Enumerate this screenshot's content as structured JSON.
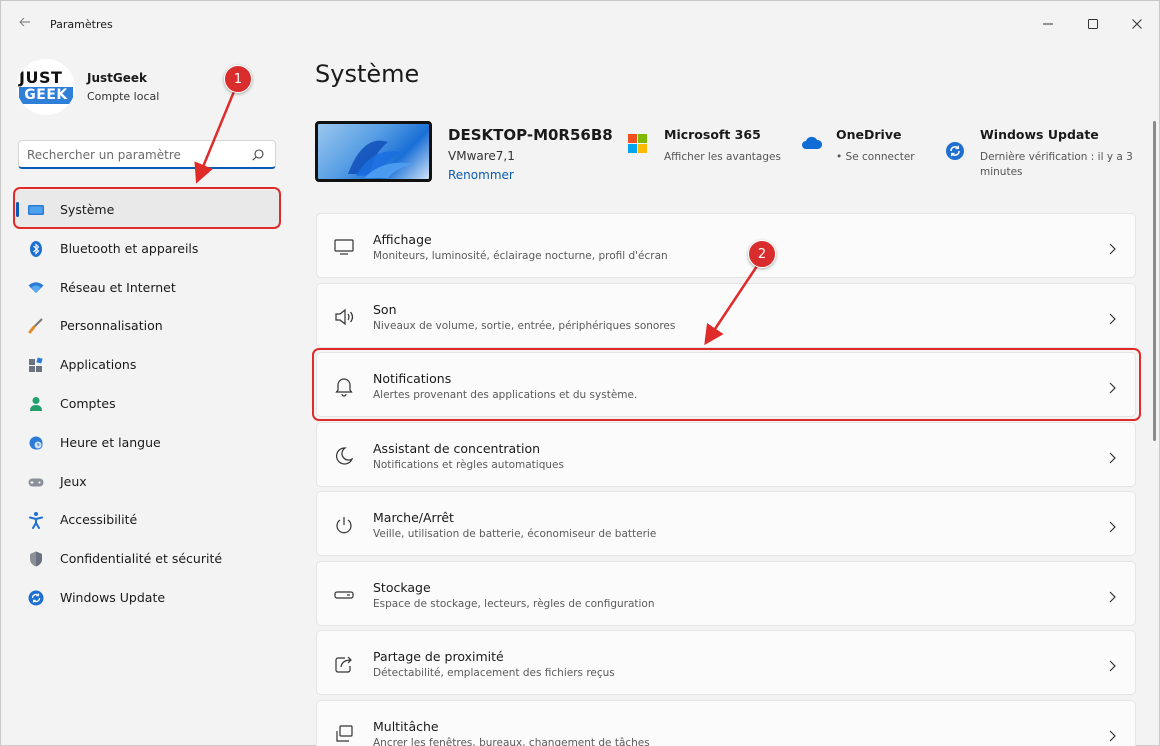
{
  "window": {
    "title": "Paramètres",
    "back_icon": "back-arrow-icon",
    "controls": [
      "minimize-icon",
      "maximize-icon",
      "close-icon"
    ]
  },
  "profile": {
    "logo_line1": "JUST",
    "logo_line2": "GEEK",
    "name": "JustGeek",
    "subtitle": "Compte local"
  },
  "search": {
    "placeholder": "Rechercher un paramètre",
    "value": ""
  },
  "sidebar": {
    "items": [
      {
        "label": "Système",
        "icon": "monitor-icon",
        "active": true
      },
      {
        "label": "Bluetooth et appareils",
        "icon": "bluetooth-icon"
      },
      {
        "label": "Réseau et Internet",
        "icon": "wifi-icon"
      },
      {
        "label": "Personnalisation",
        "icon": "brush-icon"
      },
      {
        "label": "Applications",
        "icon": "apps-icon"
      },
      {
        "label": "Comptes",
        "icon": "person-icon"
      },
      {
        "label": "Heure et langue",
        "icon": "globe-clock-icon"
      },
      {
        "label": "Jeux",
        "icon": "gamepad-icon"
      },
      {
        "label": "Accessibilité",
        "icon": "accessibility-icon"
      },
      {
        "label": "Confidentialité et sécurité",
        "icon": "shield-icon"
      },
      {
        "label": "Windows Update",
        "icon": "update-icon"
      }
    ]
  },
  "main": {
    "title": "Système",
    "device": {
      "name": "DESKTOP-M0R56B8",
      "model": "VMware7,1",
      "rename": "Renommer"
    },
    "info": [
      {
        "title": "Microsoft 365",
        "subtitle": "Afficher les avantages",
        "icon": "microsoft-logo-icon"
      },
      {
        "title": "OneDrive",
        "subtitle": "• Se connecter",
        "icon": "cloud-icon"
      },
      {
        "title": "Windows Update",
        "subtitle": "Dernière vérification : il y a 3 minutes",
        "icon": "sync-icon"
      }
    ],
    "cards": [
      {
        "title": "Affichage",
        "subtitle": "Moniteurs, luminosité, éclairage nocturne, profil d'écran",
        "icon": "display-icon"
      },
      {
        "title": "Son",
        "subtitle": "Niveaux de volume, sortie, entrée, périphériques sonores",
        "icon": "speaker-icon"
      },
      {
        "title": "Notifications",
        "subtitle": "Alertes provenant des applications et du système.",
        "icon": "bell-icon"
      },
      {
        "title": "Assistant de concentration",
        "subtitle": "Notifications et règles automatiques",
        "icon": "moon-icon"
      },
      {
        "title": "Marche/Arrêt",
        "subtitle": "Veille, utilisation de batterie, économiseur de batterie",
        "icon": "power-icon"
      },
      {
        "title": "Stockage",
        "subtitle": "Espace de stockage, lecteurs, règles de configuration",
        "icon": "storage-icon"
      },
      {
        "title": "Partage de proximité",
        "subtitle": "Détectabilité, emplacement des fichiers reçus",
        "icon": "share-icon"
      },
      {
        "title": "Multitâche",
        "subtitle": "Ancrer les fenêtres, bureaux, changement de tâches",
        "icon": "multitask-icon"
      }
    ]
  },
  "annotations": {
    "badge1": "1",
    "badge2": "2",
    "color": "#e02b2b"
  },
  "colors": {
    "accent": "#0a5bb5",
    "background": "#f3f3f3",
    "card": "#fbfbfb"
  }
}
